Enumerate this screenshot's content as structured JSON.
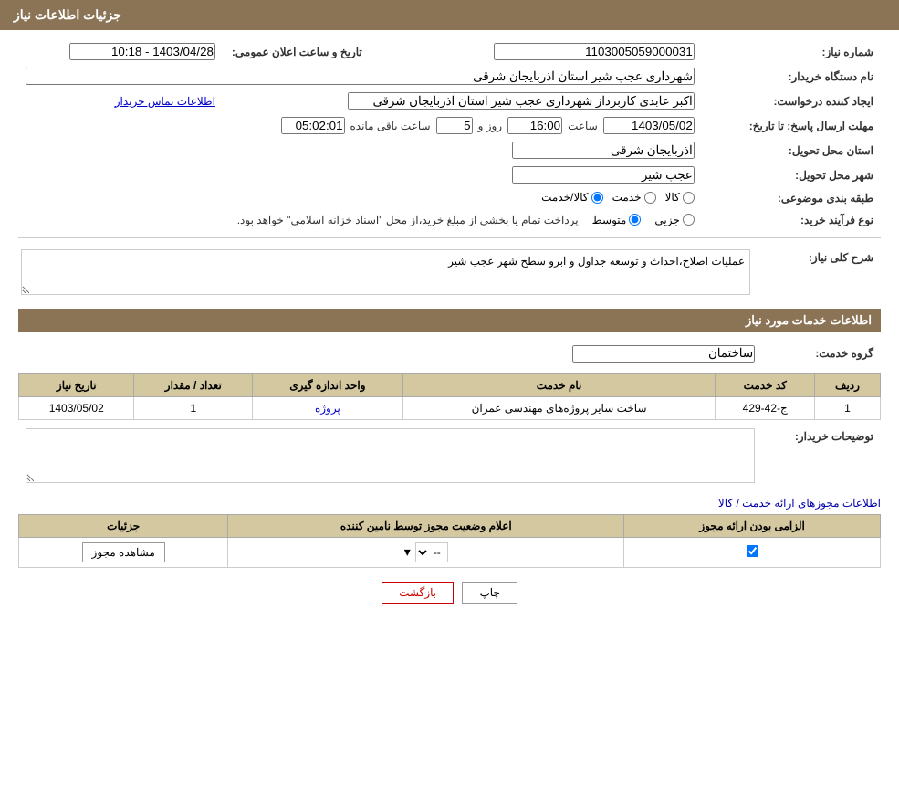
{
  "header": {
    "title": "جزئیات اطلاعات نیاز"
  },
  "fields": {
    "need_number_label": "شماره نیاز:",
    "need_number_value": "1103005059000031",
    "announcement_label": "تاریخ و ساعت اعلان عمومی:",
    "announcement_value": "1403/04/28 - 10:18",
    "buyer_org_label": "نام دستگاه خریدار:",
    "buyer_org_value": "شهرداری عجب شیر استان اذربایجان شرقی",
    "requester_label": "ایجاد کننده درخواست:",
    "requester_value": "اکبر عابدی کاربرداز شهرداری عجب شیر استان اذربایجان شرقی",
    "contact_link": "اطلاعات تماس خریدار",
    "reply_deadline_label": "مهلت ارسال پاسخ: تا تاریخ:",
    "reply_date_value": "1403/05/02",
    "reply_time_label": "ساعت",
    "reply_time_value": "16:00",
    "days_label": "روز و",
    "days_value": "5",
    "remaining_label": "ساعت باقی مانده",
    "remaining_value": "05:02:01",
    "province_label": "استان محل تحویل:",
    "province_value": "اذربایجان شرقی",
    "city_label": "شهر محل تحویل:",
    "city_value": "عجب شیر",
    "category_label": "طبقه بندی موضوعی:",
    "category_kala": "کالا",
    "category_khadamat": "خدمت",
    "category_kala_khadamat": "کالا/خدمت",
    "purchase_type_label": "نوع فرآیند خرید:",
    "purchase_jozei": "جزیی",
    "purchase_mottavaset": "متوسط",
    "purchase_note": "پرداخت تمام یا بخشی از مبلغ خرید،از محل \"اسناد خزانه اسلامی\" خواهد بود.",
    "general_desc_label": "شرح کلی نیاز:",
    "general_desc_value": "عملیات اصلاح،احداث و توسعه جداول و ابرو سطح شهر عجب شیر",
    "services_info_title": "اطلاعات خدمات مورد نیاز",
    "service_group_label": "گروه خدمت:",
    "service_group_value": "ساختمان",
    "table_headers": {
      "row_num": "ردیف",
      "service_code": "کد خدمت",
      "service_name": "نام خدمت",
      "unit": "واحد اندازه گیری",
      "quantity": "تعداد / مقدار",
      "need_date": "تاریخ نیاز"
    },
    "table_rows": [
      {
        "row": "1",
        "code": "ج-42-429",
        "name": "ساخت سایر پروژه‌های مهندسی عمران",
        "unit": "پروژه",
        "quantity": "1",
        "date": "1403/05/02"
      }
    ],
    "buyer_notes_label": "توضیحات خریدار:",
    "buyer_notes_value": "",
    "permissions_title": "اطلاعات مجوزهای ارائه خدمت / کالا",
    "perm_table_headers": {
      "required": "الزامی بودن ارائه مجوز",
      "status": "اعلام وضعیت مجوز توسط نامین کننده",
      "details": "جزئیات"
    },
    "perm_rows": [
      {
        "required_checked": true,
        "status_value": "--",
        "details_label": "مشاهده مجوز"
      }
    ]
  },
  "buttons": {
    "print_label": "چاپ",
    "return_label": "بازگشت"
  }
}
